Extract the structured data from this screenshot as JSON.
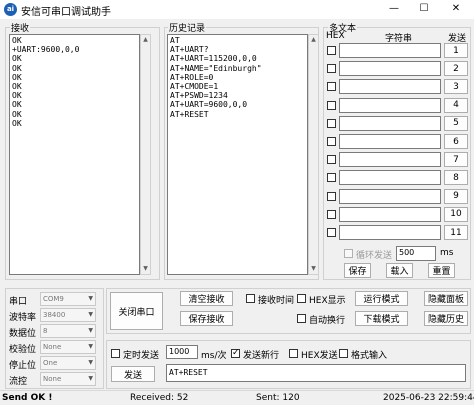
{
  "window": {
    "title": "安信可串口调试助手",
    "icon_text": "ai",
    "controls": [
      "—",
      "☐",
      "✕"
    ]
  },
  "receive": {
    "label": "接收",
    "lines": [
      "OK",
      "+UART:9600,0,0",
      "OK",
      "OK",
      "OK",
      "OK",
      "OK",
      "OK",
      "OK",
      "OK"
    ]
  },
  "history": {
    "label": "历史记录",
    "lines": [
      "AT",
      "AT+UART?",
      "AT+UART=115200,0,0",
      "AT+NAME=\"Edinburgh\"",
      "AT+ROLE=0",
      "AT+CMODE=1",
      "AT+PSWD=1234",
      "AT+UART=9600,0,0",
      "AT+RESET"
    ]
  },
  "multitext": {
    "label": "多文本",
    "col_hex": "HEX",
    "col_string": "字符串",
    "col_send": "发送",
    "rows": [
      "1",
      "2",
      "3",
      "4",
      "5",
      "6",
      "7",
      "8",
      "9",
      "10",
      "11"
    ],
    "loop_send_label": "循环发送",
    "loop_interval": "500",
    "loop_unit": "ms",
    "save_label": "保存",
    "load_label": "载入",
    "reset_label": "重置"
  },
  "serial": {
    "port_label": "串口",
    "port_value": "COM9",
    "baud_label": "波特率",
    "baud_value": "38400",
    "databits_label": "数据位",
    "databits_value": "8",
    "parity_label": "校验位",
    "parity_value": "None",
    "stopbits_label": "停止位",
    "stopbits_value": "One",
    "flow_label": "流控",
    "flow_value": "None",
    "close_port_label": "关闭串口"
  },
  "controls": {
    "clear_receive": "清空接收",
    "save_receive": "保存接收",
    "recv_time": "接收时间",
    "hex_display": "HEX显示",
    "auto_wrap": "自动换行",
    "run_mode": "运行模式",
    "download_mode": "下载模式",
    "hide_panel": "隐藏面板",
    "hide_history": "隐藏历史"
  },
  "send": {
    "timed_send": "定时发送",
    "interval": "1000",
    "interval_unit": "ms/次",
    "send_newline": "发送新行",
    "hex_send": "HEX发送",
    "format_input": "格式输入",
    "send_button": "发送",
    "input_value": "AT+RESET"
  },
  "status": {
    "send_ok": "Send OK !",
    "received": "Received: 52",
    "sent": "Sent: 120",
    "datetime": "2025-06-23 22:59:44"
  },
  "colors": {
    "accent": "#0078d7",
    "icon": "#1c5fb5"
  }
}
